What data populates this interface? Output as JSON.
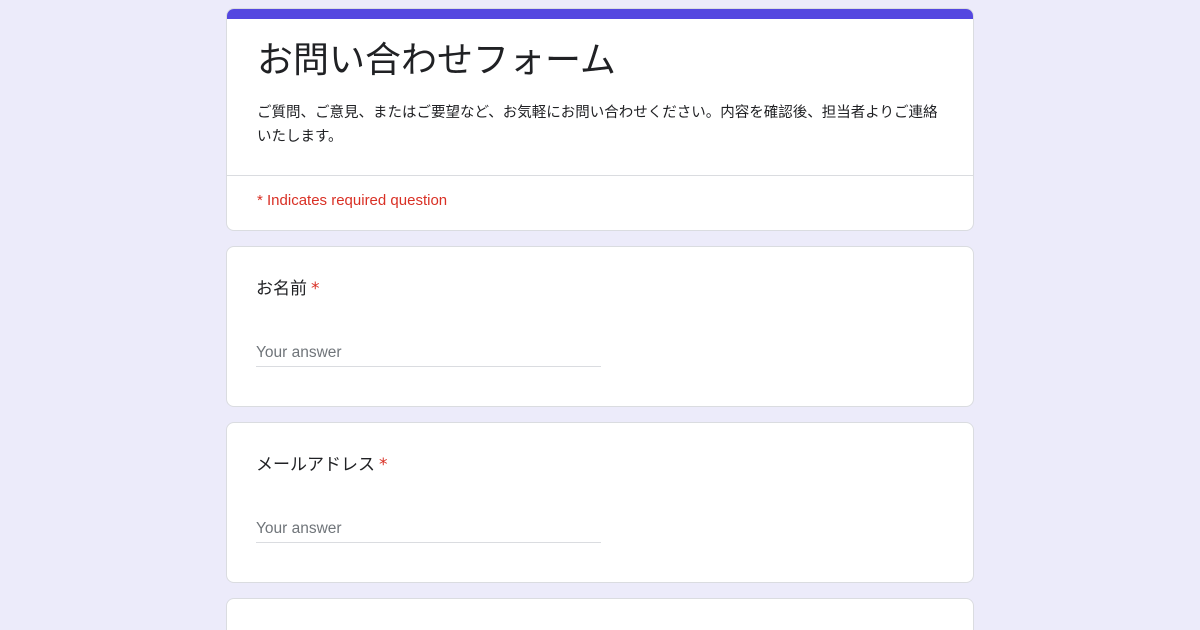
{
  "form": {
    "title": "お問い合わせフォーム",
    "description": "ご質問、ご意見、またはご要望など、お気軽にお問い合わせください。内容を確認後、担当者よりご連絡いたします。",
    "required_note": "* Indicates required question"
  },
  "questions": [
    {
      "label": "お名前",
      "required_mark": "*",
      "placeholder": "Your answer",
      "value": ""
    },
    {
      "label": "メールアドレス",
      "required_mark": "*",
      "placeholder": "Your answer",
      "value": ""
    }
  ],
  "colors": {
    "accent": "#5447e0",
    "background": "#ecebfa",
    "required": "#d93025"
  }
}
